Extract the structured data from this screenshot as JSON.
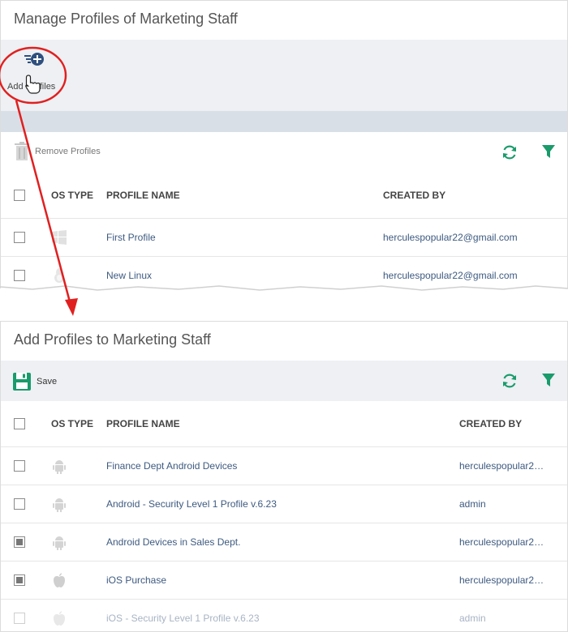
{
  "manage_panel": {
    "title": "Manage Profiles of Marketing Staff",
    "add_profiles_label": "Add Profiles",
    "remove_profiles_label": "Remove Profiles",
    "columns": [
      "OS TYPE",
      "PROFILE NAME",
      "CREATED BY"
    ],
    "rows": [
      {
        "os": "windows-icon",
        "name": "First Profile",
        "created_by": "herculespopular22@gmail.com",
        "checked": false
      },
      {
        "os": "linux-icon",
        "name": "New Linux",
        "created_by": "herculespopular22@gmail.com",
        "checked": false
      }
    ]
  },
  "add_panel": {
    "title": "Add Profiles to Marketing Staff",
    "save_label": "Save",
    "columns": [
      "OS TYPE",
      "PROFILE NAME",
      "CREATED BY"
    ],
    "rows": [
      {
        "os": "android-icon",
        "name": "Finance Dept Android Devices",
        "created_by": "herculespopular2…",
        "checked": false
      },
      {
        "os": "android-icon",
        "name": "Android - Security Level 1 Profile v.6.23",
        "created_by": "admin",
        "checked": false
      },
      {
        "os": "android-icon",
        "name": "Android Devices in Sales Dept.",
        "created_by": "herculespopular2…",
        "checked": true
      },
      {
        "os": "apple-icon",
        "name": "iOS Purchase",
        "created_by": "herculespopular2…",
        "checked": true
      },
      {
        "os": "apple-icon",
        "name": "iOS - Security Level 1 Profile v.6.23",
        "created_by": "admin",
        "checked": false
      }
    ]
  },
  "colors": {
    "accent_green": "#1a9b6c",
    "link_blue": "#3d5a80",
    "annotation_red": "#e02020",
    "band_gray": "#eef0f3"
  }
}
